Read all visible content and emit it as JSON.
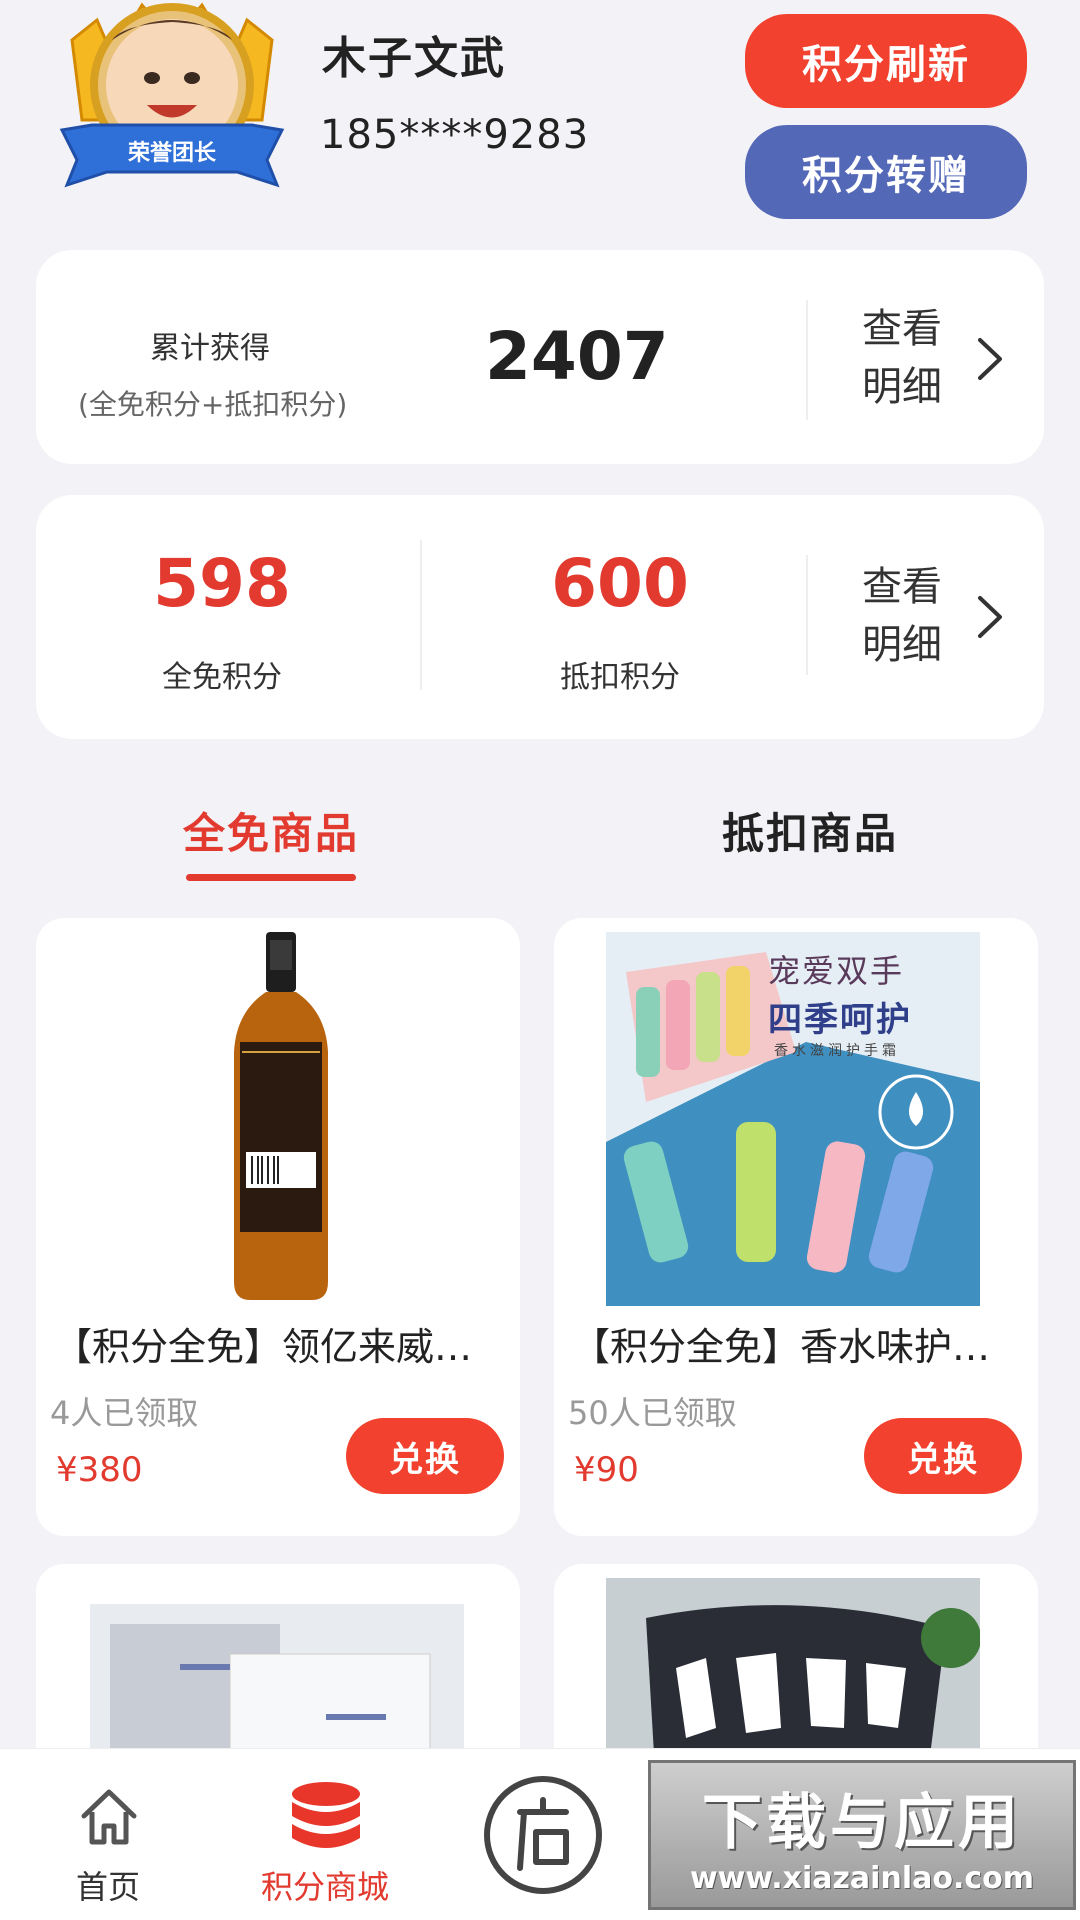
{
  "user": {
    "name": "木子文武",
    "phone": "185****9283",
    "badge": "荣誉团长"
  },
  "header_buttons": {
    "refresh_label": "积分刷新",
    "transfer_label": "积分转赠"
  },
  "cumulative": {
    "label": "累计获得",
    "sub_label": "(全免积分+抵扣积分)",
    "value": "2407",
    "detail_label_line1": "查看",
    "detail_label_line2": "明细"
  },
  "points": {
    "free_value": "598",
    "free_label": "全免积分",
    "deduct_value": "600",
    "deduct_label": "抵扣积分",
    "detail_label_line1": "查看",
    "detail_label_line2": "明细"
  },
  "tabs": [
    {
      "label": "全免商品",
      "active": true
    },
    {
      "label": "抵扣商品",
      "active": false
    }
  ],
  "products": [
    {
      "title": "【积分全免】领亿来威…",
      "claimed": "4人已领取",
      "price": "¥380",
      "button": "兑换"
    },
    {
      "title": "【积分全免】香水味护…",
      "claimed": "50人已领取",
      "price": "¥90",
      "button": "兑换",
      "image_text_1": "宠爱双手",
      "image_text_2": "四季呵护",
      "image_text_3": "香水滋润护手霜"
    }
  ],
  "bottom_nav": [
    {
      "label": "首页",
      "icon": "home-icon",
      "active": false
    },
    {
      "label": "积分商城",
      "icon": "database-icon",
      "active": true
    },
    {
      "label": "",
      "icon": "store-icon",
      "active": false
    }
  ],
  "colors": {
    "accent": "#e23a2f",
    "button_red": "#f2412e",
    "button_blue": "#5468b8",
    "background": "#f3f2f6"
  },
  "watermark": {
    "title": "下载与应用",
    "url": "www.xiazainlao.com"
  }
}
